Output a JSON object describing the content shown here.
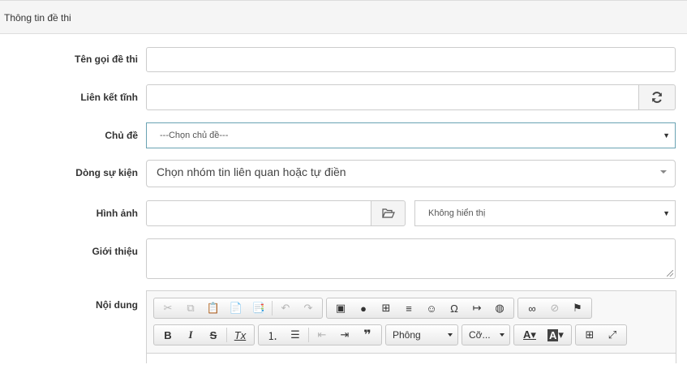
{
  "panel": {
    "title": "Thông tin đề thi"
  },
  "fields": {
    "name": {
      "label": "Tên gọi đề thi",
      "value": ""
    },
    "static_link": {
      "label": "Liên kết tĩnh",
      "value": "",
      "refresh_icon": "refresh-icon"
    },
    "topic": {
      "label": "Chủ đề",
      "selected": "---Chọn chủ đề---"
    },
    "event_line": {
      "label": "Dòng sự kiện",
      "placeholder": "Chọn nhóm tin liên quan hoặc tự điền"
    },
    "image": {
      "label": "Hình ảnh",
      "value": "",
      "browse_icon": "folder-open-icon",
      "display_selected": "Không hiển thị"
    },
    "intro": {
      "label": "Giới thiệu",
      "value": ""
    },
    "content": {
      "label": "Nội dung"
    }
  },
  "editor": {
    "font_combo": "Phông",
    "size_combo": "Cỡ...",
    "row1_icons": [
      "cut-icon",
      "copy-icon",
      "paste-icon",
      "paste-text-icon",
      "paste-word-icon",
      "undo-icon",
      "redo-icon",
      "image-icon",
      "flash-icon",
      "table-icon",
      "horizontal-rule-icon",
      "smiley-icon",
      "special-char-icon",
      "page-break-icon",
      "iframe-icon",
      "link-icon",
      "unlink-icon",
      "anchor-icon"
    ],
    "row2_icons": [
      "bold-icon",
      "italic-icon",
      "strike-icon",
      "remove-format-icon",
      "numbered-list-icon",
      "bulleted-list-icon",
      "outdent-icon",
      "indent-icon",
      "blockquote-icon",
      "text-color-icon",
      "bg-color-icon",
      "show-blocks-icon",
      "maximize-icon"
    ]
  }
}
